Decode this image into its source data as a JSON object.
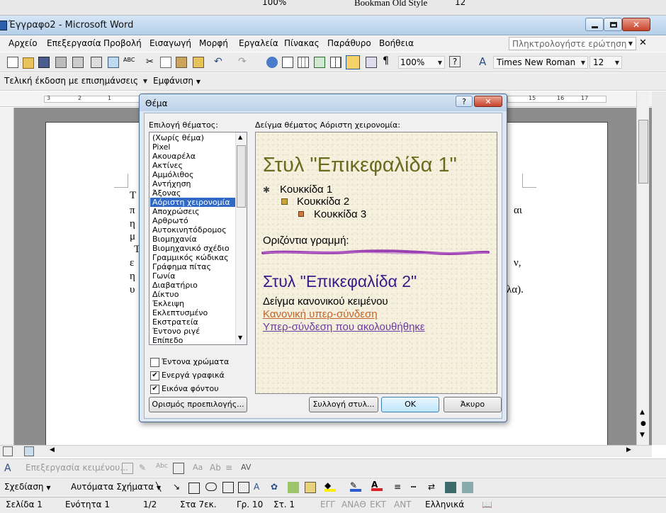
{
  "top_strip": {
    "font": "Bookman Old Style",
    "size": "12",
    "zoom": "100%"
  },
  "window": {
    "title": "Έγγραφο2 - Microsoft Word"
  },
  "menu": {
    "items": [
      "Αρχείο",
      "Επεξεργασία",
      "Προβολή",
      "Εισαγωγή",
      "Μορφή",
      "Εργαλεία",
      "Πίνακας",
      "Παράθυρο",
      "Βοήθεια"
    ],
    "help_box_placeholder": "Πληκτρολογήστε ερώτηση"
  },
  "toolbar": {
    "zoom": "100%",
    "font": "Times New Roman",
    "size": "12"
  },
  "reviewing": {
    "display_mode": "Τελική έκδοση με επισημάνσεις",
    "show_label": "Εμφάνιση"
  },
  "ruler": {
    "left_numbers": [
      "3",
      "2",
      "1"
    ],
    "right_numbers": [
      "15",
      "16",
      "17"
    ]
  },
  "doc": {
    "frag1": "Τ",
    "frag2": "π",
    "frag3": "η",
    "frag4": "μ",
    "frag5": "Τ",
    "frag6": "ε",
    "frag7": "η",
    "frag8": "υ",
    "right1": "αι",
    "right2": "ν,",
    "right3": "λα)."
  },
  "dialog": {
    "title": "Θέμα",
    "help": "?",
    "close": "✕",
    "list_label": "Επιλογή θέματος:",
    "preview_label": "Δείγμα θέματος Αόριστη χειρονομία:",
    "themes": [
      "(Χωρίς θέμα)",
      "Pixel",
      "Ακουαρέλα",
      "Ακτίνες",
      "Αμμόλιθος",
      "Αντήχηση",
      "Άξονας",
      "Αόριστη χειρονομία",
      "Αποχρώσεις",
      "Αρθρωτό",
      "Αυτοκινητόδρομος",
      "Βιομηχανία",
      "Βιομηχανικό σχέδιο",
      "Γραμμικός κώδικας",
      "Γράφημα πίτας",
      "Γωνία",
      "Διαβατήριο",
      "Δίκτυο",
      "Έκλειψη",
      "Εκλεπτυσμένο",
      "Εκστρατεία",
      "Έντονο ριγέ",
      "Επίπεδο"
    ],
    "selected_index": 7,
    "options": [
      {
        "label": "Έντονα χρώματα",
        "checked": false
      },
      {
        "label": "Ενεργά γραφικά",
        "checked": true
      },
      {
        "label": "Εικόνα φόντου",
        "checked": true
      }
    ],
    "preview": {
      "heading1": "Στυλ \"Επικεφαλίδα 1\"",
      "bullet1": "Κουκκίδα 1",
      "bullet2": "Κουκκίδα 2",
      "bullet3": "Κουκκίδα 3",
      "hr_label": "Οριζόντια γραμμή:",
      "heading2": "Στυλ \"Επικεφαλίδα 2\"",
      "normal_text": "Δείγμα κανονικού κειμένου",
      "link": "Κανονική υπερ-σύνδεση",
      "visited_link": "Υπερ-σύνδεση που ακολουθήθηκε"
    },
    "buttons": {
      "set_default": "Ορισμός προεπιλογής...",
      "style_gallery": "Συλλογή στυλ...",
      "ok": "OK",
      "cancel": "Άκυρο"
    }
  },
  "drawing_bar": {
    "text_edit": "Επεξεργασία κειμένου...",
    "draw": "Σχεδίαση",
    "autoshapes": "Αυτόματα Σχήματα"
  },
  "status": {
    "page": "Σελίδα 1",
    "section": "Ενότητα 1",
    "pages": "1/2",
    "at": "Στα 7εκ.",
    "line": "Γρ. 10",
    "col": "Στ. 1",
    "modes": [
      "ΕΓΓ",
      "ΑΝΑΘ",
      "ΕΚΤ",
      "ΑΝΤ"
    ],
    "language": "Ελληνικά"
  },
  "colors": {
    "heading1": "#6b6b1f",
    "heading2": "#3b1a8a",
    "link": "#c0652b",
    "visited": "#6a3aa0",
    "hr": "#9a3fb0",
    "selection": "#3169c6",
    "title_bar": "#bcd5ee",
    "paper": "#f6f1df"
  }
}
